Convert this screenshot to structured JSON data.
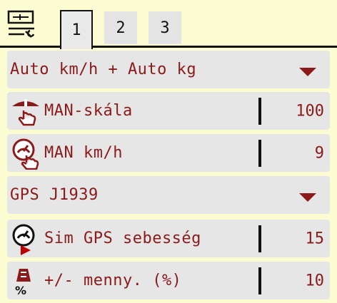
{
  "tabs": [
    {
      "label": "1",
      "active": true
    },
    {
      "label": "2",
      "active": false
    },
    {
      "label": "3",
      "active": false
    }
  ],
  "rows": {
    "mode_select": {
      "label": "Auto km/h + Auto kg"
    },
    "man_scale": {
      "label": "MAN-skála",
      "value": "100",
      "icon": "hand-spread-icon"
    },
    "man_speed": {
      "label": "MAN km/h",
      "value": "9",
      "icon": "hand-speedometer-icon"
    },
    "speed_source": {
      "label": "GPS J1939"
    },
    "sim_gps": {
      "label": "Sim GPS sebesség",
      "value": "15",
      "icon": "speedometer-play-icon"
    },
    "qty_percent": {
      "label": "+/- menny. (%)",
      "value": "10",
      "icon": "weight-percent-icon"
    }
  },
  "colors": {
    "text": "#8b1a1a",
    "background": "#fcfcd2",
    "row": "#e6e6e6"
  }
}
